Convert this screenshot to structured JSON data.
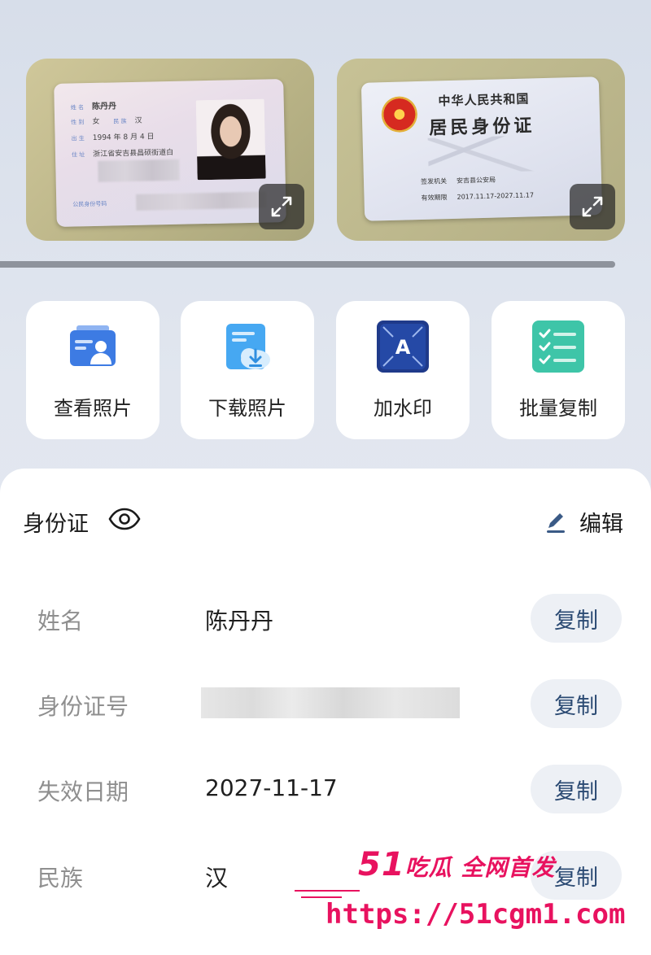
{
  "id_front": {
    "name_label": "姓 名",
    "name": "陈丹丹",
    "gender_label": "性 别",
    "gender": "女",
    "ethnicity_label": "民 族",
    "ethnicity": "汉",
    "birth_label": "出 生",
    "birth": "1994 年 8 月 4 日",
    "address_label": "住 址",
    "address": "浙江省安吉县昌硕街道白",
    "id_number_label": "公民身份号码"
  },
  "id_back": {
    "country": "中华人民共和国",
    "title": "居民身份证",
    "authority_label": "签发机关",
    "authority": "安吉县公安局",
    "validity_label": "有效期限",
    "validity": "2017.11.17-2027.11.17"
  },
  "actions": [
    {
      "label": "查看照片",
      "icon": "view-photo-icon"
    },
    {
      "label": "下载照片",
      "icon": "download-photo-icon"
    },
    {
      "label": "加水印",
      "icon": "watermark-icon"
    },
    {
      "label": "批量复制",
      "icon": "batch-copy-icon"
    }
  ],
  "panel": {
    "title": "身份证",
    "edit_label": "编辑"
  },
  "rows": [
    {
      "label": "姓名",
      "value": "陈丹丹",
      "copy": "复制"
    },
    {
      "label": "身份证号",
      "value": "",
      "copy": "复制"
    },
    {
      "label": "失效日期",
      "value": "2027-11-17",
      "copy": "复制"
    },
    {
      "label": "民族",
      "value": "汉",
      "copy": "复制"
    }
  ],
  "watermark": {
    "num": "51",
    "text": "吃瓜 全网首发",
    "url": "https://51cgm1.com"
  },
  "colors": {
    "accent": "#2b4a73",
    "copy_bg": "#edf0f5",
    "watermark": "#e8125f"
  }
}
